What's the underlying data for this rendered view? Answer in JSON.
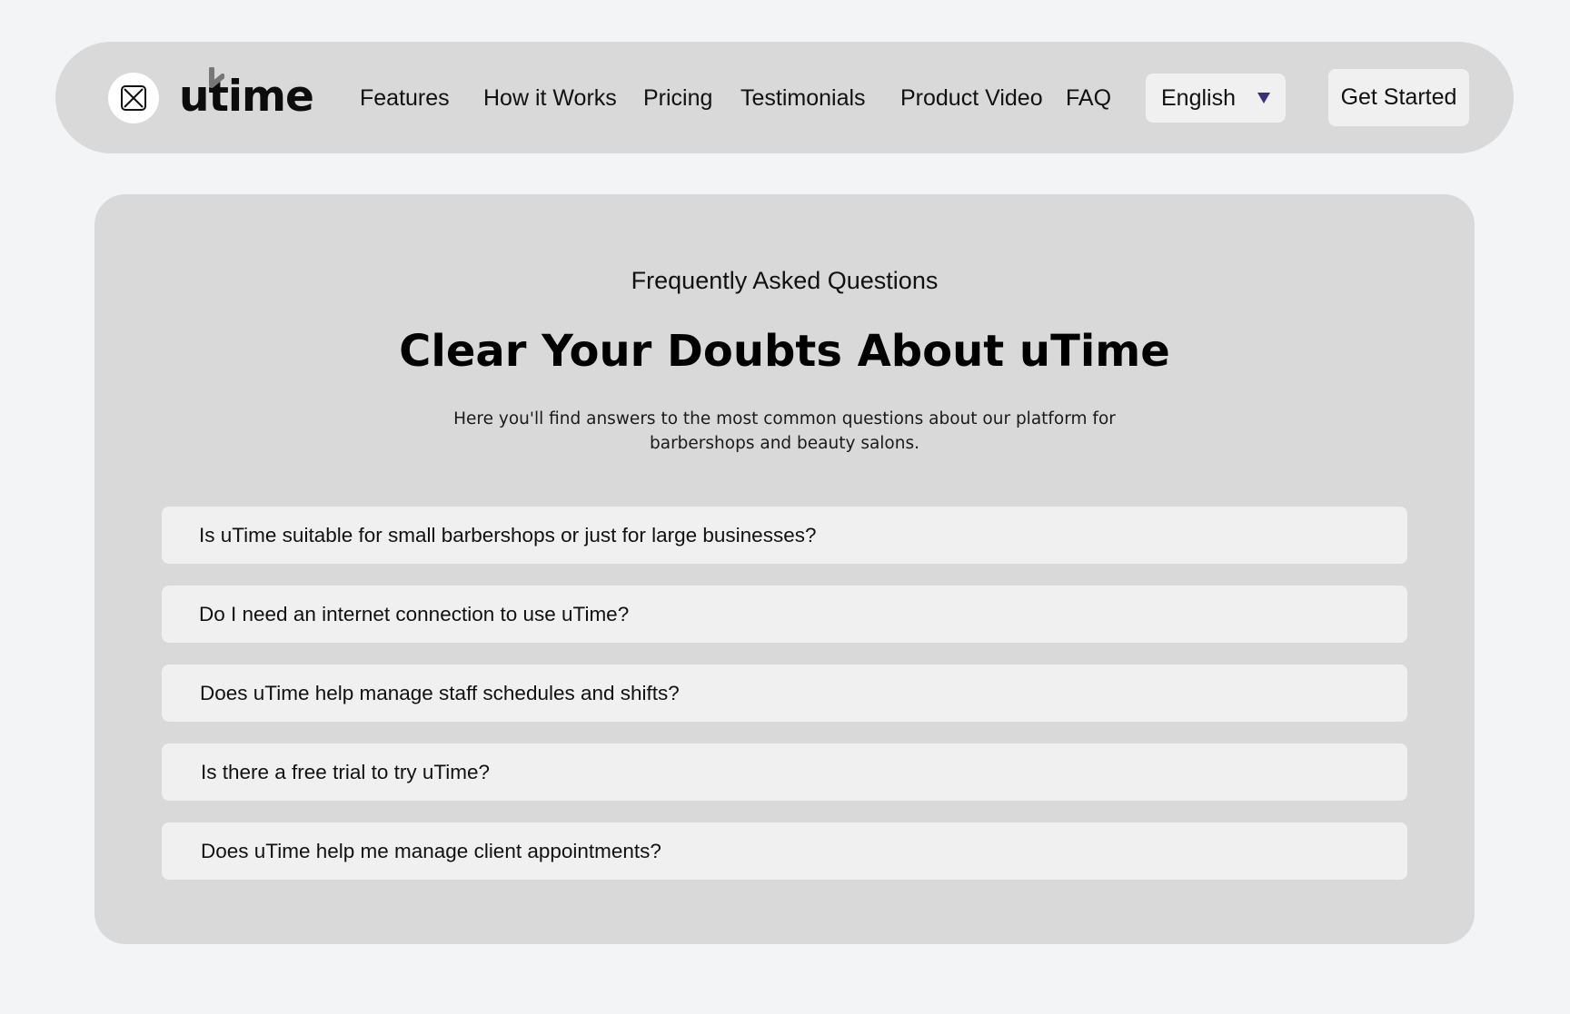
{
  "brand": {
    "wordmark": "utime",
    "logo_icon": "image-placeholder-icon"
  },
  "nav": {
    "links": [
      {
        "label": "Features"
      },
      {
        "label": "How it Works"
      },
      {
        "label": "Pricing"
      },
      {
        "label": "Testimonials"
      },
      {
        "label": "Product Video"
      },
      {
        "label": "FAQ"
      }
    ],
    "language": {
      "selected": "English",
      "caret_icon": "caret-down-icon",
      "caret_color": "#3b2f7a"
    },
    "cta_label": "Get Started"
  },
  "faq": {
    "eyebrow": "Frequently Asked Questions",
    "headline": "Clear Your Doubts About uTime",
    "intro": "Here you'll find answers to the most common questions about our platform for barbershops and beauty salons.",
    "items": [
      {
        "question": "Is uTime suitable for small barbershops or just for large businesses?"
      },
      {
        "question": "Do I need an internet connection to use uTime?"
      },
      {
        "question": "Does uTime help manage staff schedules and shifts?"
      },
      {
        "question": "Is there a free trial to try uTime?"
      },
      {
        "question": "Does uTime help me manage client appointments?"
      }
    ]
  },
  "colors": {
    "page_background": "#f3f4f5",
    "panel_background": "#d9d9d9",
    "item_background": "#f0f0f0",
    "text": "#111111"
  }
}
